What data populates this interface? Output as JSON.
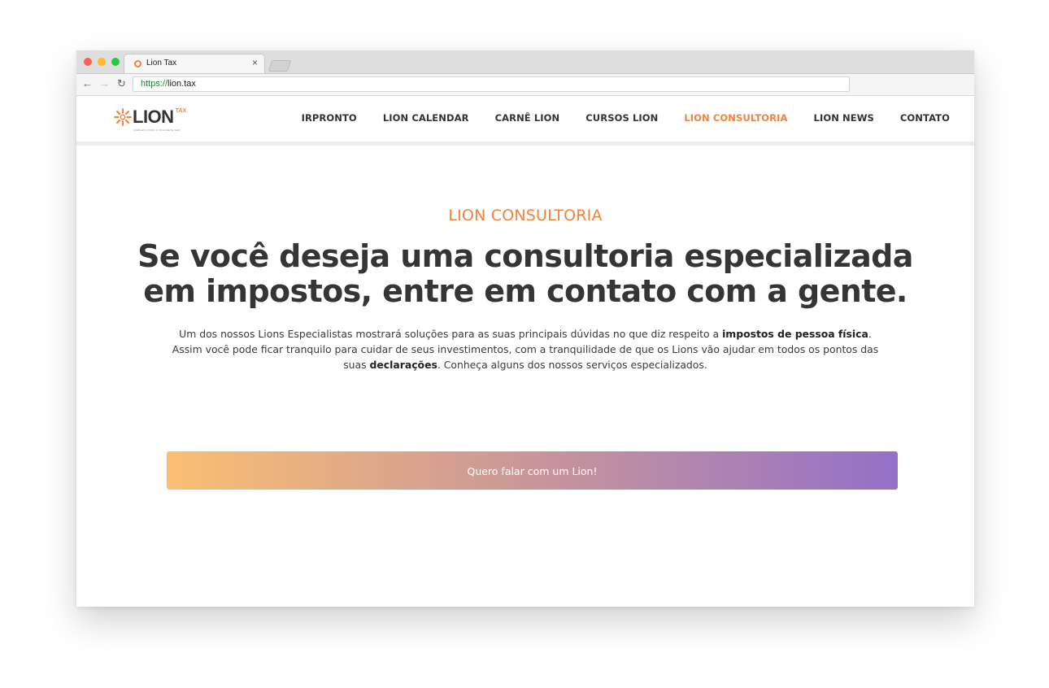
{
  "browser": {
    "tab_title": "Lion Tax",
    "tab_close": "×",
    "url_scheme": "https://",
    "url_host": "lion.tax",
    "back": "←",
    "forward": "→",
    "reload": "↻"
  },
  "site": {
    "logo_text": "LION",
    "logo_tax": "TAX",
    "logo_tagline": "SIMPLES COMO A VIDA DEVE SER",
    "brand_color": "#f5823c",
    "nav": [
      {
        "label": "IRPRONTO",
        "active": false
      },
      {
        "label": "LION CALENDAR",
        "active": false
      },
      {
        "label": "CARNÊ LION",
        "active": false
      },
      {
        "label": "CURSOS LION",
        "active": false
      },
      {
        "label": "LION CONSULTORIA",
        "active": true
      },
      {
        "label": "LION NEWS",
        "active": false
      },
      {
        "label": "CONTATO",
        "active": false
      }
    ]
  },
  "hero": {
    "eyebrow": "LION CONSULTORIA",
    "title": "Se você deseja uma consultoria especializada em impostos, entre em contato com a gente.",
    "copy": {
      "part1": "Um dos nossos Lions Especialistas mostrará soluções para as suas principais dúvidas no que diz respeito a ",
      "bold1": "impostos de pessoa física",
      "part2": ". Assim você pode ficar tranquilo para cuidar de seus investimentos, com a tranquilidade de que os Lions vão ajudar em todos os pontos das suas ",
      "bold2": "declarações",
      "part3": ". Conheça alguns dos nossos serviços especializados."
    },
    "cta_label": "Quero falar com um Lion!",
    "cta_gradient": [
      "#fbbf72",
      "#9470c8"
    ]
  }
}
